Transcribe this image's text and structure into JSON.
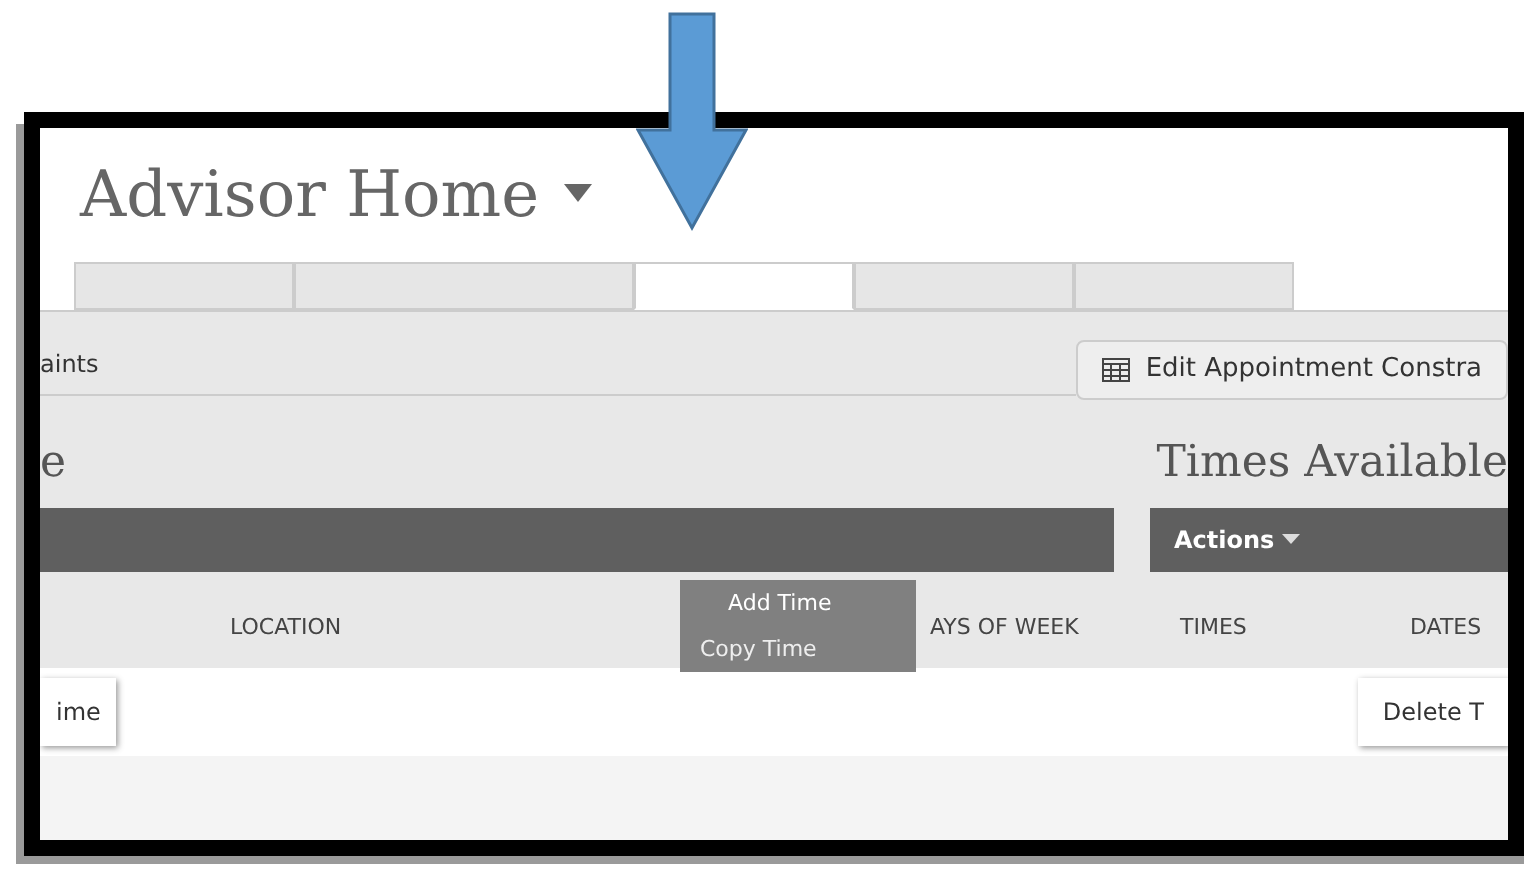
{
  "page_title": "Advisor Home",
  "tabs": [
    {
      "selected": false
    },
    {
      "selected": false
    },
    {
      "selected": true
    },
    {
      "selected": false
    },
    {
      "selected": false
    }
  ],
  "toolbar": {
    "label": "aints",
    "edit_button": "Edit Appointment Constra"
  },
  "section": {
    "left_heading": "e",
    "right_heading": "Times Available"
  },
  "actions_button": "Actions",
  "actions_menu": [
    "Add Time",
    "Copy Time"
  ],
  "table": {
    "columns": [
      "LOCATION",
      "AYS OF WEEK",
      "TIMES",
      "DATES"
    ]
  },
  "row_buttons": {
    "left": "ime",
    "right": "Delete T"
  }
}
